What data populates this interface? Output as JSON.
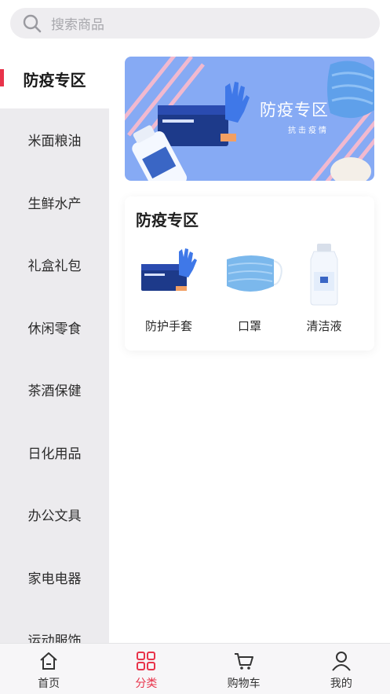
{
  "search": {
    "placeholder": "搜索商品",
    "icon": "search-icon"
  },
  "sidebar": {
    "items": [
      {
        "label": "防疫专区",
        "active": true
      },
      {
        "label": "米面粮油"
      },
      {
        "label": "生鲜水产"
      },
      {
        "label": "礼盒礼包"
      },
      {
        "label": "休闲零食"
      },
      {
        "label": "茶酒保健"
      },
      {
        "label": "日化用品"
      },
      {
        "label": "办公文具"
      },
      {
        "label": "家电电器"
      },
      {
        "label": "运动服饰"
      }
    ]
  },
  "banner": {
    "title": "防疫专区",
    "subtitle": "抗击疫情"
  },
  "section": {
    "title": "防疫专区",
    "products": [
      {
        "name": "防护手套",
        "icon": "gloves-icon"
      },
      {
        "name": "口罩",
        "icon": "mask-icon"
      },
      {
        "name": "清洁液",
        "icon": "sanitizer-bottle-icon"
      }
    ]
  },
  "tabbar": {
    "tabs": [
      {
        "label": "首页",
        "icon": "home-icon"
      },
      {
        "label": "分类",
        "icon": "category-grid-icon",
        "active": true
      },
      {
        "label": "购物车",
        "icon": "cart-icon"
      },
      {
        "label": "我的",
        "icon": "user-icon"
      }
    ]
  },
  "colors": {
    "accent": "#e8334a",
    "sidebar_bg": "#ecebee",
    "banner_bg": "#86aaf4",
    "search_bg": "#eeedf0"
  }
}
